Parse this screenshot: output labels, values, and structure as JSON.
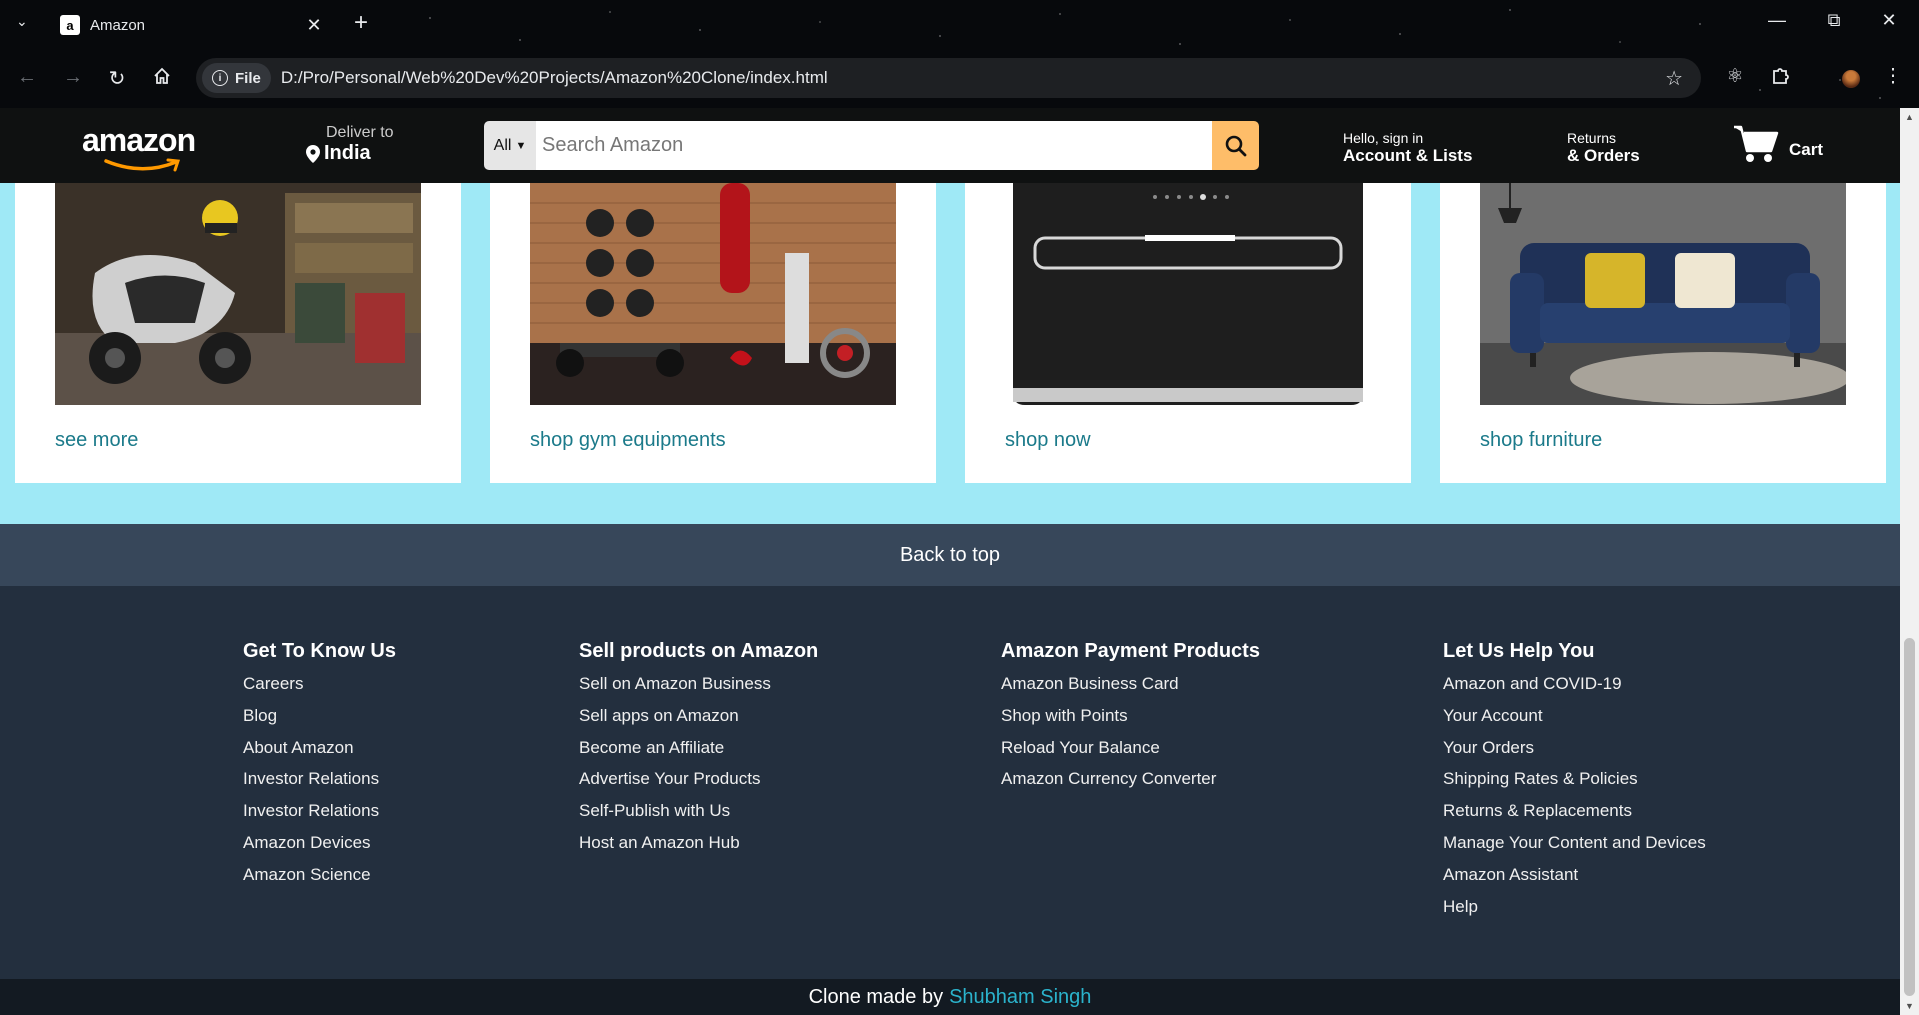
{
  "browser": {
    "tab_title": "Amazon",
    "favicon_letter": "a",
    "url_chip": "File",
    "url": "D:/Pro/Personal/Web%20Dev%20Projects/Amazon%20Clone/index.html"
  },
  "header": {
    "logo": "amazon",
    "deliver_label": "Deliver to",
    "deliver_location": "India",
    "search_category": "All",
    "search_placeholder": "Search Amazon",
    "account_line1": "Hello, sign in",
    "account_line2": "Account & Lists",
    "returns_line1": "Returns",
    "returns_line2": "& Orders",
    "cart_label": "Cart"
  },
  "cards": [
    {
      "link": "see more"
    },
    {
      "link": "shop gym equipments"
    },
    {
      "link": "shop now"
    },
    {
      "link": "shop furniture"
    }
  ],
  "back_to_top": "Back to top",
  "footer": {
    "columns": [
      {
        "heading": "Get To Know Us",
        "links": [
          "Careers",
          "Blog",
          "About Amazon",
          "Investor Relations",
          "Investor Relations",
          "Amazon Devices",
          "Amazon Science"
        ]
      },
      {
        "heading": "Sell products on Amazon",
        "links": [
          "Sell on Amazon Business",
          "Sell apps on Amazon",
          "Become an Affiliate",
          "Advertise Your Products",
          "Self-Publish with Us",
          "Host an Amazon Hub"
        ]
      },
      {
        "heading": "Amazon Payment Products",
        "links": [
          "Amazon Business Card",
          "Shop with Points",
          "Reload Your Balance",
          "Amazon Currency Converter"
        ]
      },
      {
        "heading": "Let Us Help You",
        "links": [
          "Amazon and COVID-19",
          "Your Account",
          "Your Orders",
          "Shipping Rates & Policies",
          "Returns & Replacements",
          "Manage Your Content and Devices",
          "Amazon Assistant",
          "Help"
        ]
      }
    ]
  },
  "credit": {
    "prefix": "Clone made by",
    "author": "Shubham Singh"
  },
  "colors": {
    "header_bg": "#0f1111",
    "page_bg": "#9fe9f6",
    "search_button": "#febd69",
    "back_to_top_bg": "#37475a",
    "footer_bg": "#232f3e",
    "credit_bg": "#131a22",
    "link_teal": "#1b7a8a"
  }
}
